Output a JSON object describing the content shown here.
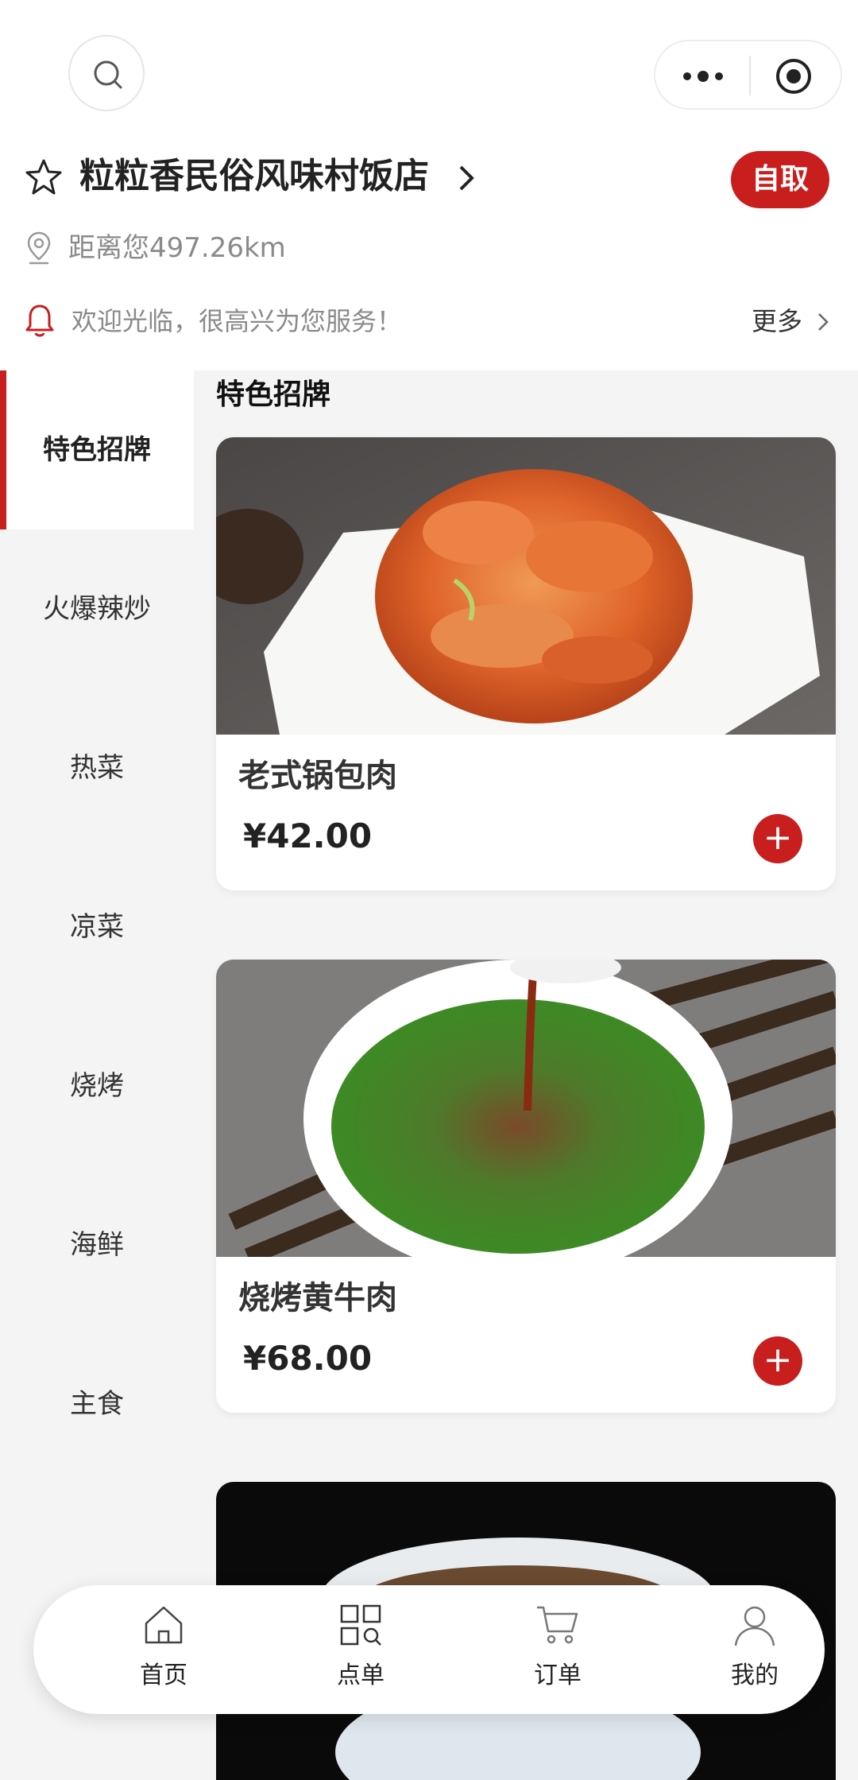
{
  "store": {
    "name": "粒粒香民俗风味村饭店",
    "pickup_label": "自取",
    "distance": "距离您497.26km",
    "notice": "欢迎光临，很高兴为您服务！",
    "more_label": "更多"
  },
  "categories": [
    {
      "label": "特色招牌",
      "active": true
    },
    {
      "label": "火爆辣炒"
    },
    {
      "label": "热菜"
    },
    {
      "label": "凉菜"
    },
    {
      "label": "烧烤"
    },
    {
      "label": "海鲜"
    },
    {
      "label": "主食"
    }
  ],
  "section_title": "特色招牌",
  "dishes": [
    {
      "name": "老式锅包肉",
      "price": "¥42.00"
    },
    {
      "name": "烧烤黄牛肉",
      "price": "¥68.00"
    }
  ],
  "tabbar": [
    {
      "label": "首页",
      "icon": "home-icon"
    },
    {
      "label": "点单",
      "icon": "menu-scan-icon"
    },
    {
      "label": "订单",
      "icon": "cart-icon"
    },
    {
      "label": "我的",
      "icon": "user-icon"
    }
  ],
  "colors": {
    "accent": "#c81e1e",
    "background": "#f4f4f4"
  }
}
